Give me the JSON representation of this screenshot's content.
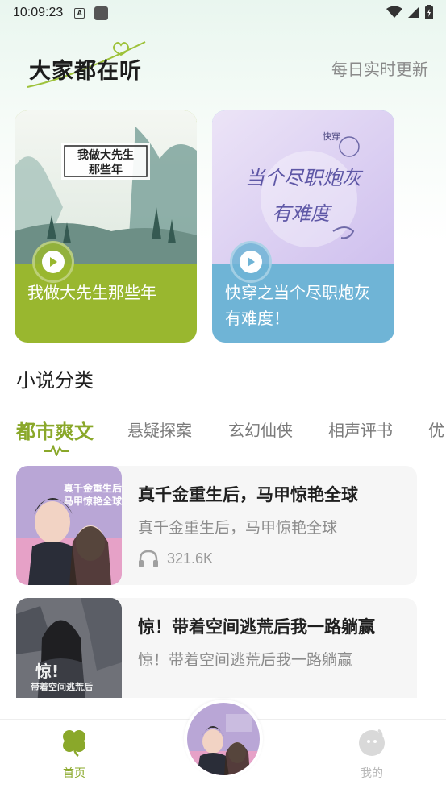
{
  "status_bar": {
    "time": "10:09:23"
  },
  "header": {
    "title": "大家都在听",
    "subtitle": "每日实时更新"
  },
  "featured": [
    {
      "title": "我做大先生那些年",
      "cover_text": [
        "我做大先生",
        "那些年"
      ],
      "color": "#99b72f"
    },
    {
      "title": "快穿之当个尽职炮灰有难度！",
      "cover_text": [
        "当个尽职炮灰",
        "有难度"
      ],
      "cover_badge": "快穿",
      "color": "#6fb4d6"
    }
  ],
  "section": {
    "title": "小说分类"
  },
  "tabs": [
    "都市爽文",
    "悬疑探案",
    "玄幻仙侠",
    "相声评书",
    "优"
  ],
  "active_tab": 0,
  "books": [
    {
      "title": "真千金重生后，马甲惊艳全球",
      "desc": "真千金重生后，马甲惊艳全球",
      "plays": "321.6K",
      "cover_text": [
        "真千金重生后",
        "马甲惊艳全球"
      ]
    },
    {
      "title": "惊！带着空间逃荒后我一路躺赢",
      "desc": "惊！带着空间逃荒后我一路躺赢",
      "cover_text": [
        "惊!",
        "带着空间逃荒后"
      ]
    }
  ],
  "nav": {
    "home": "首页",
    "mine": "我的"
  },
  "colors": {
    "accent": "#8aa82a",
    "card_green": "#99b72f",
    "card_blue": "#6fb4d6"
  },
  "icons": [
    "play-icon",
    "headphones-icon",
    "clover-icon",
    "profile-icon",
    "wifi-icon",
    "signal-icon",
    "battery-icon"
  ]
}
